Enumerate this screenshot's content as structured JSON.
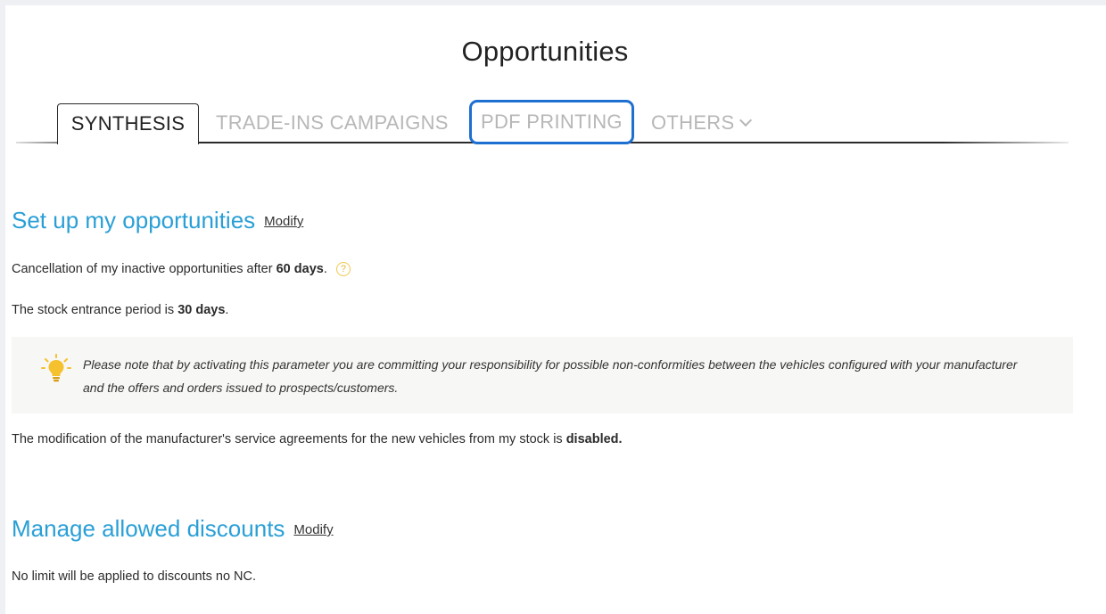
{
  "page": {
    "title": "Opportunities"
  },
  "tabs": [
    {
      "label": "SYNTHESIS",
      "active": true
    },
    {
      "label": "TRADE-INS CAMPAIGNS",
      "active": false
    },
    {
      "label": "PDF PRINTING",
      "active": false,
      "focused": true
    },
    {
      "label": "OTHERS",
      "active": false,
      "has_dropdown": true
    }
  ],
  "setup": {
    "title": "Set up my opportunities",
    "modify_label": "Modify",
    "cancellation_prefix": "Cancellation of my inactive opportunities after",
    "cancellation_value": "60 days",
    "cancellation_suffix": ".",
    "help_icon": "?",
    "stock_prefix": "The stock entrance period is",
    "stock_value": "30 days",
    "stock_suffix": ".",
    "notice": "Please note that by activating this parameter you are committing your responsibility for possible non-conformities between the vehicles configured with your manufacturer and the offers and orders issued to prospects/customers.",
    "notice_icon": "lightbulb-icon",
    "modification_prefix": "The modification of the manufacturer's service agreements for the new vehicles from my stock is",
    "modification_value": "disabled."
  },
  "discounts": {
    "title": "Manage allowed discounts",
    "modify_label": "Modify",
    "limit_text": "No limit will be applied to discounts no NC."
  },
  "colors": {
    "accent": "#2a9fd6",
    "focus_ring": "#1d6fd1",
    "help_icon": "#f2c94c",
    "bulb": "#f6c12e"
  }
}
